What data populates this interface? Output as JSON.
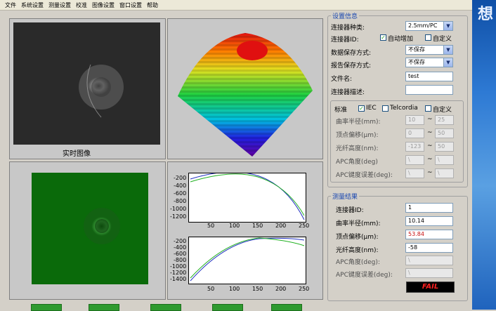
{
  "menu": [
    "文件",
    "系统设置",
    "测量设置",
    "校准",
    "图像设置",
    "窗口设置",
    "帮助"
  ],
  "desktop_glyph": "想",
  "image_panel": {
    "caption": "实时图像"
  },
  "plots": {
    "top": {
      "yticks": [
        "-200",
        "-400",
        "-600",
        "-800",
        "-1000",
        "-1200"
      ],
      "xticks": [
        "50",
        "100",
        "150",
        "200",
        "250"
      ]
    },
    "bottom": {
      "yticks": [
        "-200",
        "-400",
        "-600",
        "-800",
        "-1000",
        "-1200",
        "-1400"
      ],
      "xticks": [
        "50",
        "100",
        "150",
        "200",
        "250"
      ]
    }
  },
  "settings": {
    "title": "设置信息",
    "connector_type_label": "连接器种类:",
    "connector_type_value": "2.5mm/PC",
    "connector_id_label": "连接器ID:",
    "auto_increment_label": "自动增加",
    "custom_label": "自定义",
    "data_save_label": "数据保存方式:",
    "data_save_value": "不保存",
    "report_save_label": "报告保存方式:",
    "report_save_value": "不保存",
    "filename_label": "文件名:",
    "filename_value": "test",
    "description_label": "连接器描述:",
    "description_value": "",
    "standard_label": "标准",
    "iec_label": "IEC",
    "telcordia_label": "Telcordia",
    "std_custom_label": "自定义",
    "params": [
      {
        "label": "曲率半径(mm):",
        "min": "10",
        "max": "25"
      },
      {
        "label": "顶点偏移(μm):",
        "min": "0",
        "max": "50"
      },
      {
        "label": "光纤高度(nm):",
        "min": "-123",
        "max": "50"
      },
      {
        "label": "APC角度(deg)",
        "min": "\\",
        "max": "\\"
      },
      {
        "label": "APC键度误差(deg):",
        "min": "\\",
        "max": "\\"
      }
    ],
    "tilde": "~"
  },
  "results": {
    "title": "测量结果",
    "rows": [
      {
        "label": "连接器ID:",
        "value": "1"
      },
      {
        "label": "曲率半径(mm):",
        "value": "10.14"
      },
      {
        "label": "顶点偏移(μm):",
        "value": "53.84"
      },
      {
        "label": "光纤高度(nm):",
        "value": "-58"
      },
      {
        "label": "APC角度(deg):",
        "value": "\\"
      },
      {
        "label": "APC键度误差(deg):",
        "value": "\\"
      }
    ],
    "status": "FAIL"
  }
}
